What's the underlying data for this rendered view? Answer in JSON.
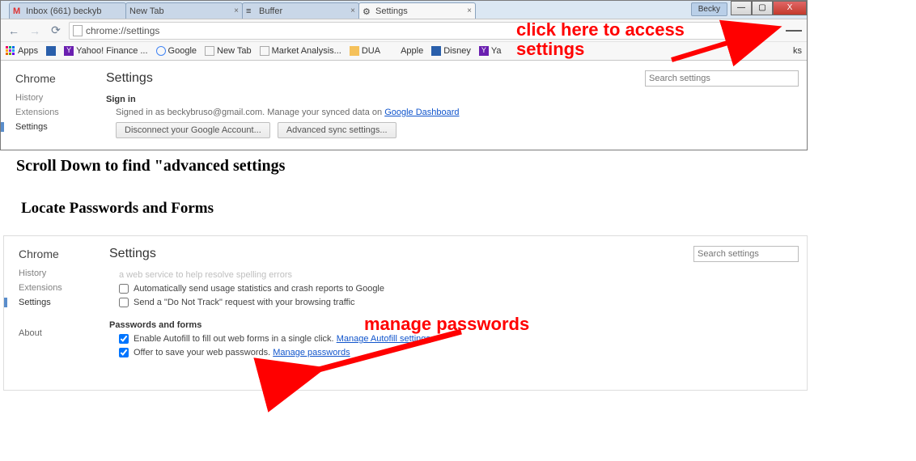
{
  "window": {
    "user_badge": "Becky",
    "tabs": [
      {
        "label": "Inbox (661)   beckyb"
      },
      {
        "label": "New Tab"
      },
      {
        "label": "Buffer"
      },
      {
        "label": "Settings"
      }
    ],
    "omnibox": "chrome://settings",
    "bookmarks": [
      "Apps",
      "",
      "Yahoo! Finance ...",
      "Google",
      "New Tab",
      "Market Analysis...",
      "DUA",
      "Apple",
      "Disney",
      "Ya"
    ],
    "other_bm_trunc": "ks"
  },
  "settings1": {
    "heading": "Chrome",
    "title": "Settings",
    "side": [
      "History",
      "Extensions",
      "Settings"
    ],
    "search_ph": "Search settings",
    "signin_h": "Sign in",
    "signin_desc_a": "Signed in as beckybruso@gmail.com. Manage your synced data on ",
    "signin_link": "Google Dashboard",
    "btn_disc": "Disconnect your Google Account...",
    "btn_adv": "Advanced sync settings..."
  },
  "settings2": {
    "heading": "Chrome",
    "title": "Settings",
    "side": [
      "History",
      "Extensions",
      "Settings"
    ],
    "about": "About",
    "search_ph": "Search settings",
    "grey0": "a web service to help resolve spelling errors",
    "cb1": "Automatically send usage statistics and crash reports to Google",
    "cb2": "Send a \"Do Not Track\" request with your browsing traffic",
    "pf_h": "Passwords and forms",
    "cb3a": "Enable Autofill to fill out web forms in a single click. ",
    "cb3l": "Manage Autofill settings",
    "cb4a": "Offer to save your web passwords. ",
    "cb4l": "Manage passwords"
  },
  "headlines": {
    "h1": "Scroll Down to find \"advanced settings",
    "h2": "Locate Passwords and Forms"
  },
  "callouts": {
    "c1a": "click here to access",
    "c1b": "settings",
    "c2": "manage passwords"
  }
}
